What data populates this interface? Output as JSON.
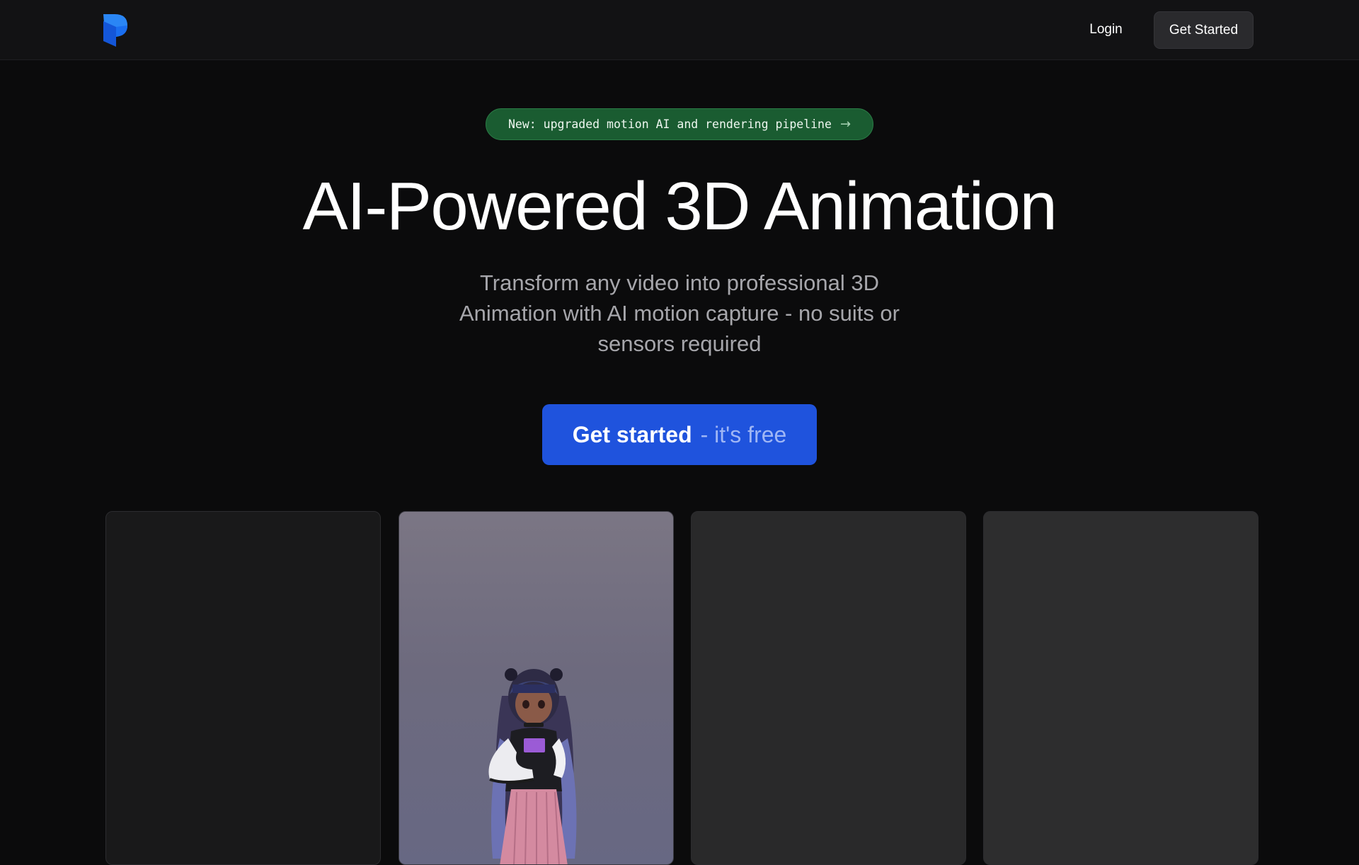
{
  "nav": {
    "logo_name": "brand-logo",
    "login_label": "Login",
    "cta_label": "Get Started"
  },
  "hero": {
    "announcement": "New: upgraded motion AI and rendering pipeline",
    "announcement_icon": "arrow-right-icon",
    "title": "AI-Powered 3D Animation",
    "subtitle": "Transform any video into professional 3D Animation with AI motion capture - no suits or sensors required",
    "cta_main": "Get started",
    "cta_suffix": "- it's free"
  },
  "cards": [
    {
      "name": "video-card-1",
      "state": "empty"
    },
    {
      "name": "video-card-2",
      "state": "anime-avatar"
    },
    {
      "name": "video-card-3",
      "state": "empty"
    },
    {
      "name": "video-card-4",
      "state": "empty"
    }
  ],
  "colors": {
    "background": "#0b0b0c",
    "nav_background": "#121214",
    "accent_blue": "#1f53dd",
    "announce_green": "#1a5c31",
    "muted_text": "#a6a6ab"
  }
}
